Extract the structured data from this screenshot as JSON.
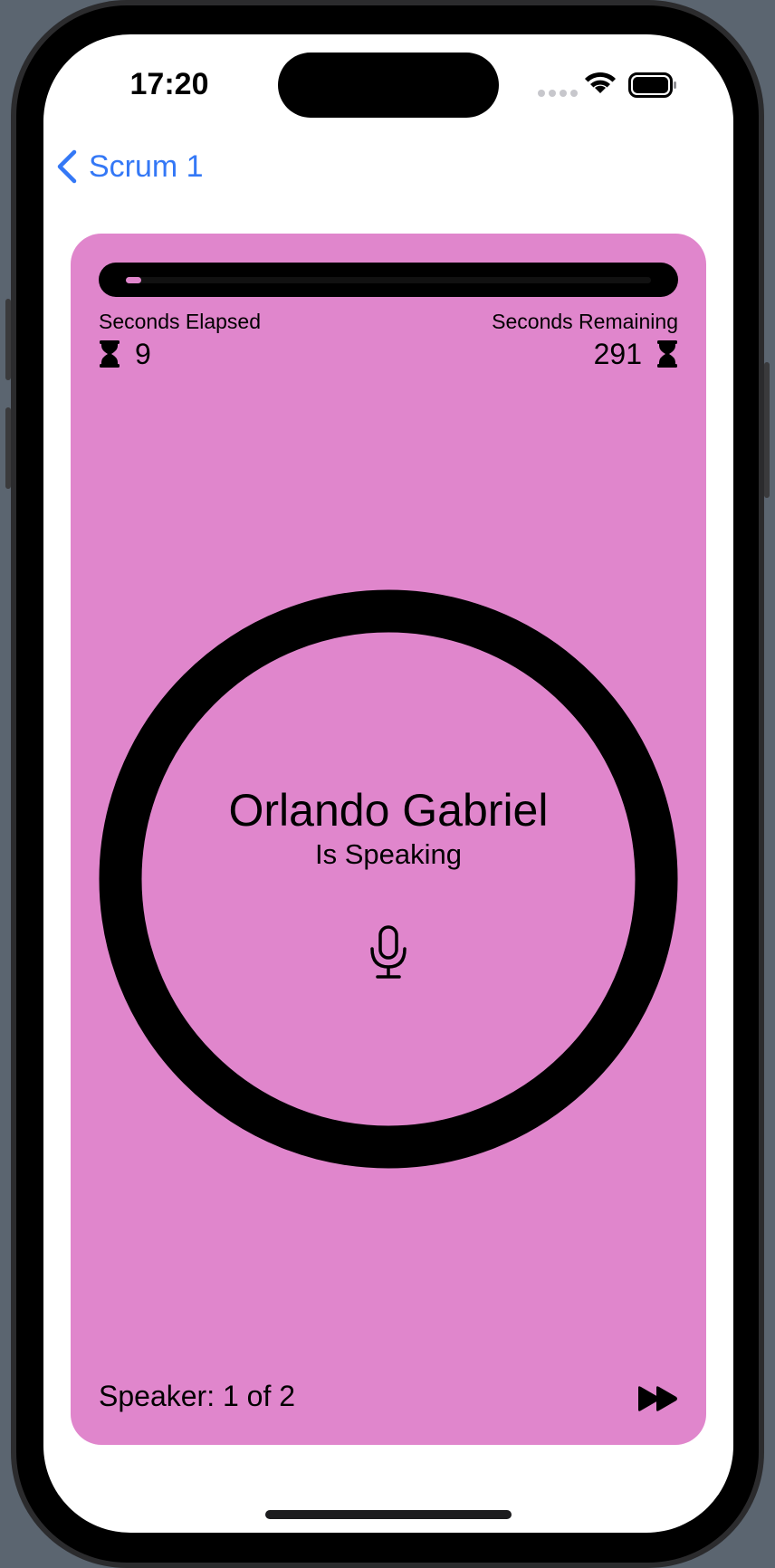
{
  "status_bar": {
    "time": "17:20"
  },
  "nav": {
    "back_label": "Scrum 1"
  },
  "meeting": {
    "elapsed_label": "Seconds Elapsed",
    "elapsed_value": "9",
    "remaining_label": "Seconds Remaining",
    "remaining_value": "291",
    "progress": 0.03,
    "speaker_name": "Orlando Gabriel",
    "speaking_status": "Is Speaking",
    "speaker_count": "Speaker: 1 of 2"
  },
  "theme": {
    "accent": "#e086cc",
    "link": "#3478f6",
    "foreground": "#000000"
  },
  "icons": {
    "back": "chevron-left-icon",
    "hourglass": "hourglass-icon",
    "microphone": "mic-icon",
    "skip": "forward-icon"
  }
}
